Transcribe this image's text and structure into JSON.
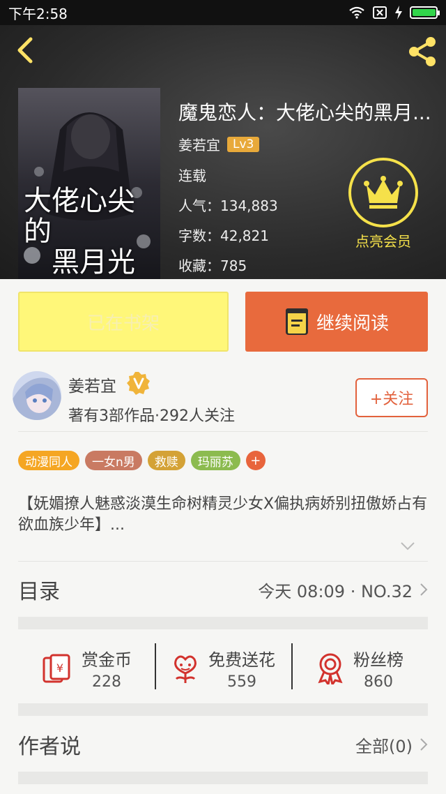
{
  "status_bar": {
    "time": "下午2:58"
  },
  "header": {
    "back_icon": "chevron-left-icon",
    "share_icon": "share-icon"
  },
  "book": {
    "cover_title_line1": "大佬心尖的",
    "cover_title_line2": "黑月光",
    "title": "魔鬼恋人：大佬心尖的黑月...",
    "author": "姜若宜",
    "level": "Lv3",
    "status": "连载",
    "popularity": "人气：134,883",
    "word_count": "字数：42,821",
    "favorites": "收藏：785"
  },
  "vip": {
    "label": "点亮会员"
  },
  "actions": {
    "shelf_label": "已在书架",
    "read_label": "继续阅读"
  },
  "author_card": {
    "name": "姜若宜",
    "stats": "著有3部作品·292人关注",
    "follow_label": "+关注"
  },
  "tags": [
    {
      "label": "动漫同人",
      "color": "#f5a623"
    },
    {
      "label": "一女n男",
      "color": "#c97a62"
    },
    {
      "label": "救赎",
      "color": "#d4a236"
    },
    {
      "label": "玛丽苏",
      "color": "#8cbb4f"
    }
  ],
  "synopsis": "【妩媚撩人魅惑淡漠生命树精灵少女X偏执病娇别扭傲娇占有欲血族少年】...",
  "catalog": {
    "title": "目录",
    "latest": "今天 08:09 · NO.32"
  },
  "stats": [
    {
      "label": "赏金币",
      "value": "228"
    },
    {
      "label": "免费送花",
      "value": "559"
    },
    {
      "label": "粉丝榜",
      "value": "860"
    }
  ],
  "author_says": {
    "title": "作者说",
    "count": "全部(0)"
  },
  "colors": {
    "accent": "#e86a3d",
    "gold": "#f5e14a",
    "shelf": "#fff779"
  }
}
